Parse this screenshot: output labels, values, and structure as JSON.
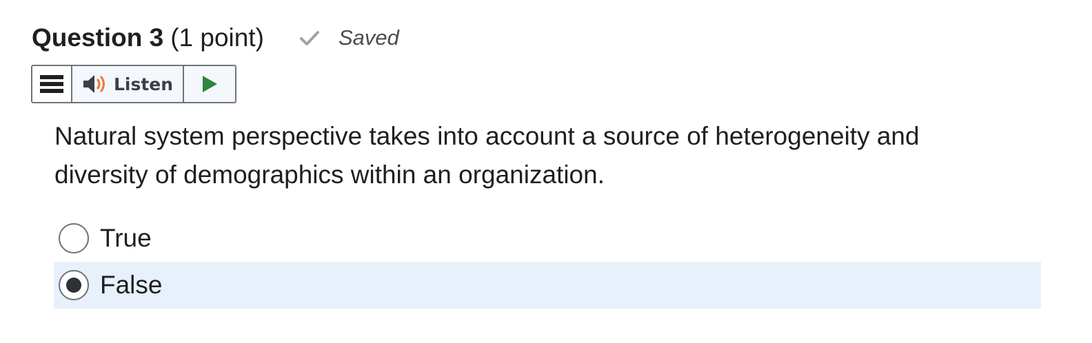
{
  "question": {
    "title": "Question 3",
    "points": "(1 point)",
    "status": "Saved",
    "text": "Natural system perspective takes into account a source of heterogeneity and diversity of demographics within an organization."
  },
  "toolbar": {
    "listen_label": "Listen",
    "icons": [
      "menu-icon",
      "speaker-icon",
      "play-icon"
    ]
  },
  "choices": [
    {
      "label": "True",
      "selected": false
    },
    {
      "label": "False",
      "selected": true
    }
  ],
  "colors": {
    "selected_row": "#e8f0fb",
    "play_green": "#2e8540",
    "speaker_dark": "#3b3f4a",
    "speaker_orange": "#e8783c",
    "check_gray": "#9ea3a6"
  }
}
